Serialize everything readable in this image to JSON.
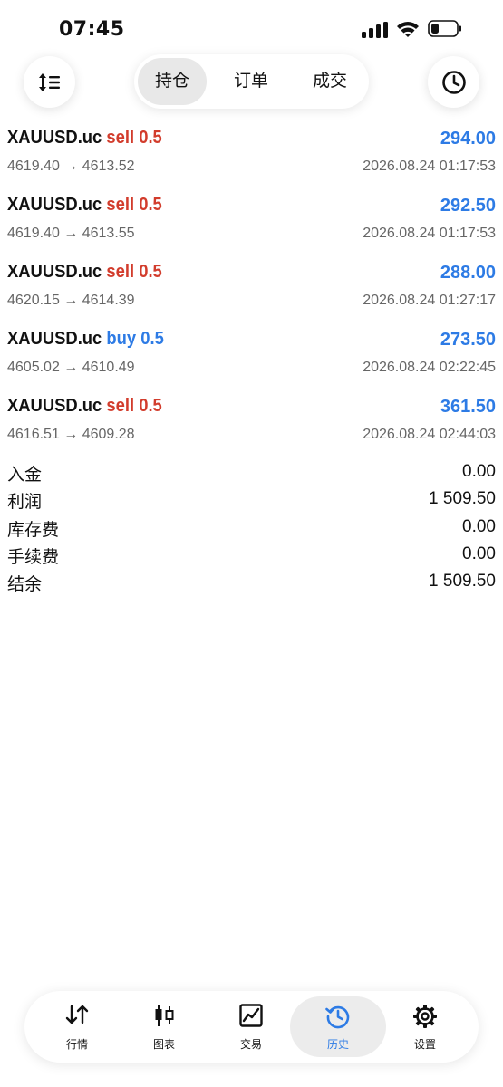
{
  "status_bar": {
    "time": "07:45"
  },
  "header": {
    "left_icon": "sort-icon",
    "right_icon": "clock-icon",
    "tabs": [
      {
        "label": "持仓",
        "active": true
      },
      {
        "label": "订单",
        "active": false
      },
      {
        "label": "成交",
        "active": false
      }
    ]
  },
  "deals": [
    {
      "symbol": "XAUUSD.uc",
      "side": "sell",
      "volume": "0.5",
      "profit": "294.00",
      "prices": "4619.40 → 4613.52",
      "time": "2026.08.24 01:17:53"
    },
    {
      "symbol": "XAUUSD.uc",
      "side": "sell",
      "volume": "0.5",
      "profit": "292.50",
      "prices": "4619.40 → 4613.55",
      "time": "2026.08.24 01:17:53"
    },
    {
      "symbol": "XAUUSD.uc",
      "side": "sell",
      "volume": "0.5",
      "profit": "288.00",
      "prices": "4620.15 → 4614.39",
      "time": "2026.08.24 01:27:17"
    },
    {
      "symbol": "XAUUSD.uc",
      "side": "buy",
      "volume": "0.5",
      "profit": "273.50",
      "prices": "4605.02 → 4610.49",
      "time": "2026.08.24 02:22:45"
    },
    {
      "symbol": "XAUUSD.uc",
      "side": "sell",
      "volume": "0.5",
      "profit": "361.50",
      "prices": "4616.51 → 4609.28",
      "time": "2026.08.24 02:44:03"
    }
  ],
  "summary": [
    {
      "label": "入金",
      "value": "0.00"
    },
    {
      "label": "利润",
      "value": "1 509.50"
    },
    {
      "label": "库存费",
      "value": "0.00"
    },
    {
      "label": "手续费",
      "value": "0.00"
    },
    {
      "label": "结余",
      "value": "1 509.50"
    }
  ],
  "nav": [
    {
      "label": "行情",
      "icon": "quotes-arrows-icon",
      "active": false
    },
    {
      "label": "图表",
      "icon": "candlestick-chart-icon",
      "active": false
    },
    {
      "label": "交易",
      "icon": "trade-chart-icon",
      "active": false
    },
    {
      "label": "历史",
      "icon": "history-icon",
      "active": true
    },
    {
      "label": "设置",
      "icon": "gear-icon",
      "active": false
    }
  ],
  "colors": {
    "sell": "#d23c2c",
    "buy": "#2d7be5",
    "profit": "#2d7be5",
    "accent": "#2d7be5"
  }
}
